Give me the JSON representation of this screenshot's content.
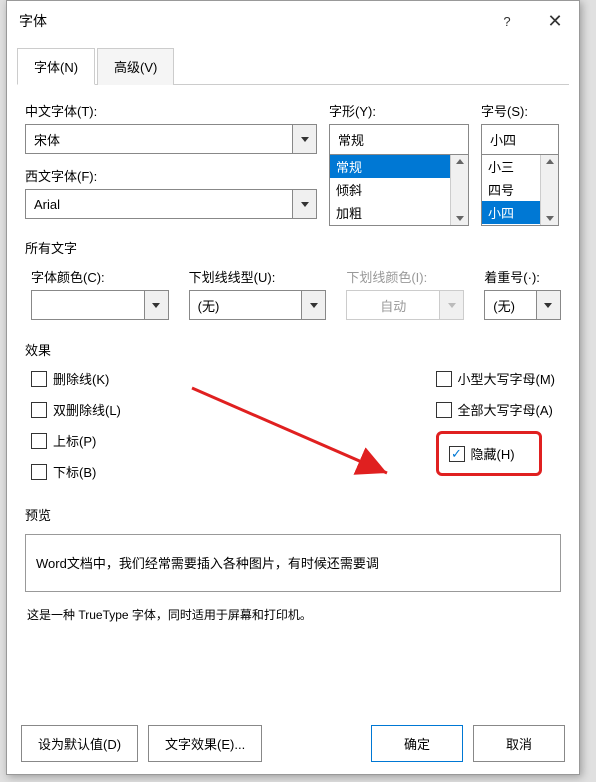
{
  "dialog": {
    "title": "字体",
    "help": "?",
    "close": "✕"
  },
  "tabs": {
    "font": "字体(N)",
    "advanced": "高级(V)"
  },
  "fields": {
    "cn_font_label": "中文字体(T):",
    "cn_font_value": "宋体",
    "west_font_label": "西文字体(F):",
    "west_font_value": "Arial",
    "style_label": "字形(Y):",
    "style_value": "常规",
    "style_opts": [
      "常规",
      "倾斜",
      "加粗"
    ],
    "size_label": "字号(S):",
    "size_value": "小四",
    "size_opts": [
      "小三",
      "四号",
      "小四"
    ]
  },
  "alltext": {
    "header": "所有文字",
    "color_label": "字体颜色(C):",
    "underline_label": "下划线线型(U):",
    "underline_value": "(无)",
    "underline_color_label": "下划线颜色(I):",
    "underline_color_value": "自动",
    "emphasis_label": "着重号(·):",
    "emphasis_value": "(无)"
  },
  "effects": {
    "header": "效果",
    "strike": "删除线(K)",
    "dstrike": "双删除线(L)",
    "sup": "上标(P)",
    "sub": "下标(B)",
    "smallcaps": "小型大写字母(M)",
    "allcaps": "全部大写字母(A)",
    "hidden": "隐藏(H)"
  },
  "preview": {
    "header": "预览",
    "text": "Word文档中，我们经常需要插入各种图片，有时候还需要调",
    "desc": "这是一种 TrueType 字体，同时适用于屏幕和打印机。"
  },
  "buttons": {
    "default": "设为默认值(D)",
    "texteffects": "文字效果(E)...",
    "ok": "确定",
    "cancel": "取消"
  }
}
